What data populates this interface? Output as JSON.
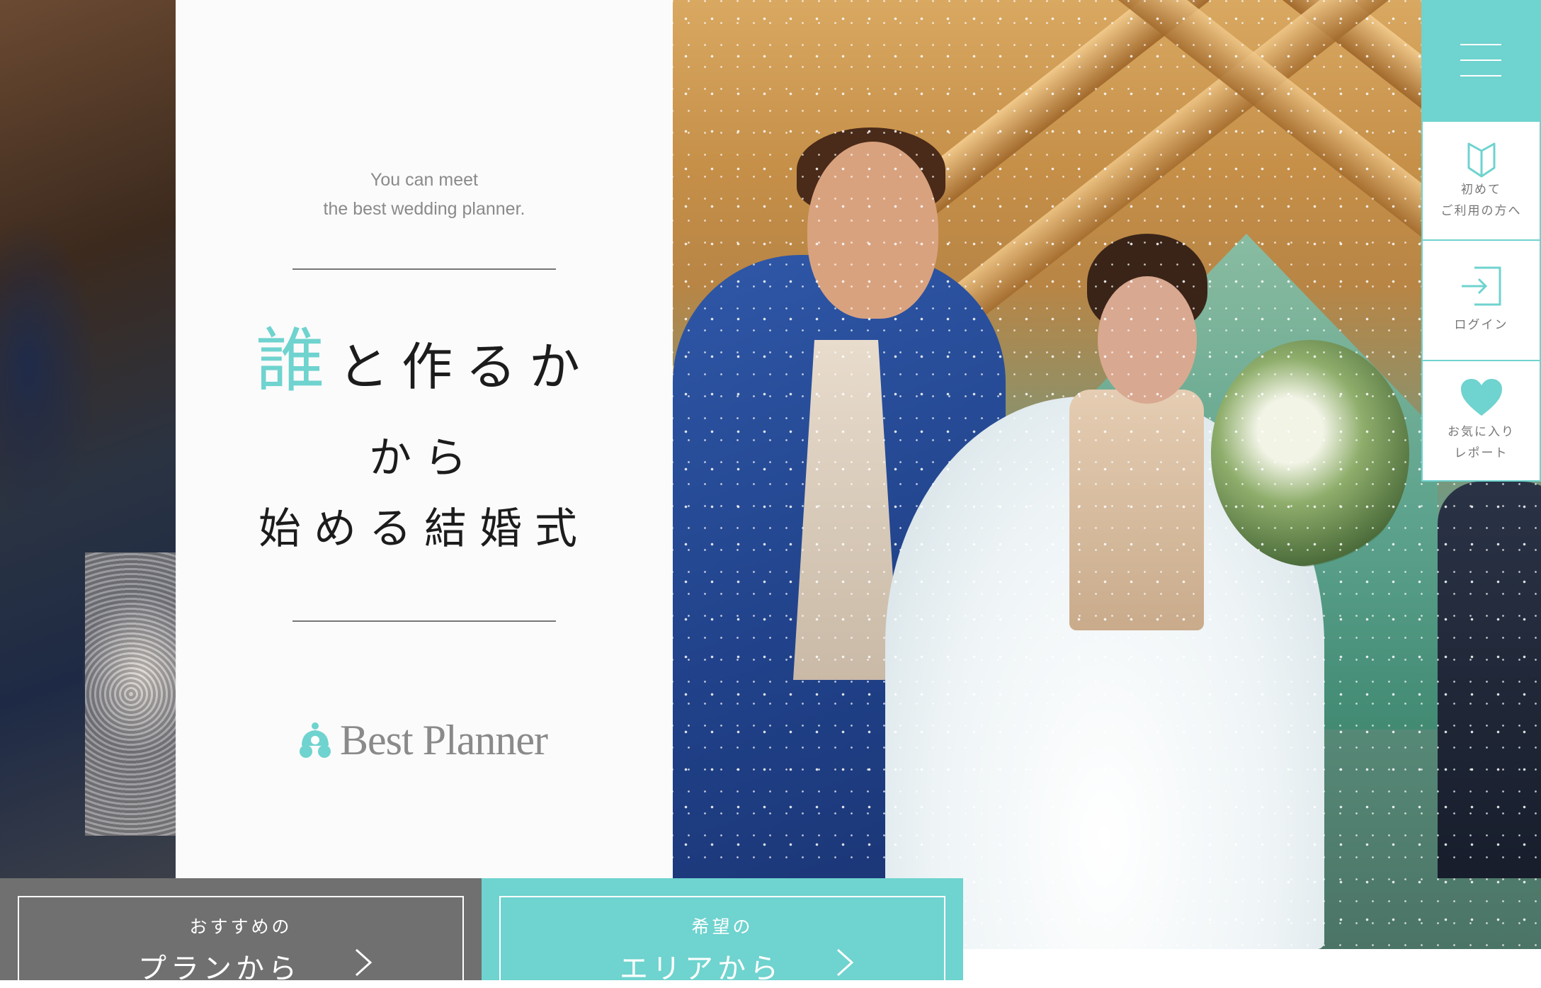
{
  "hero": {
    "tagline_line1": "You can meet",
    "tagline_line2": "the best wedding planner.",
    "headline_accent": "誰",
    "headline_line1_rest": "と作るか",
    "headline_line2": "から",
    "headline_line3": "始める結婚式",
    "logo_text": "Best Planner"
  },
  "menu": {
    "icon": "hamburger-menu-icon"
  },
  "side_nav": {
    "items": [
      {
        "label": "初めて\nご利用の方へ",
        "icon": "book-icon"
      },
      {
        "label": "ログイン",
        "icon": "login-icon"
      },
      {
        "label": "お気に入り\nレポート",
        "icon": "heart-icon"
      }
    ]
  },
  "bottom_buttons": [
    {
      "sub": "おすすめの",
      "main": "プランから",
      "icon": "chevron-right-icon"
    },
    {
      "sub": "希望の",
      "main": "エリアから",
      "icon": "chevron-right-icon"
    }
  ],
  "colors": {
    "accent": "#6fd3cf",
    "gray_button": "#707070",
    "text_dark": "#1c1c1c",
    "text_muted": "#8a8a8a"
  }
}
